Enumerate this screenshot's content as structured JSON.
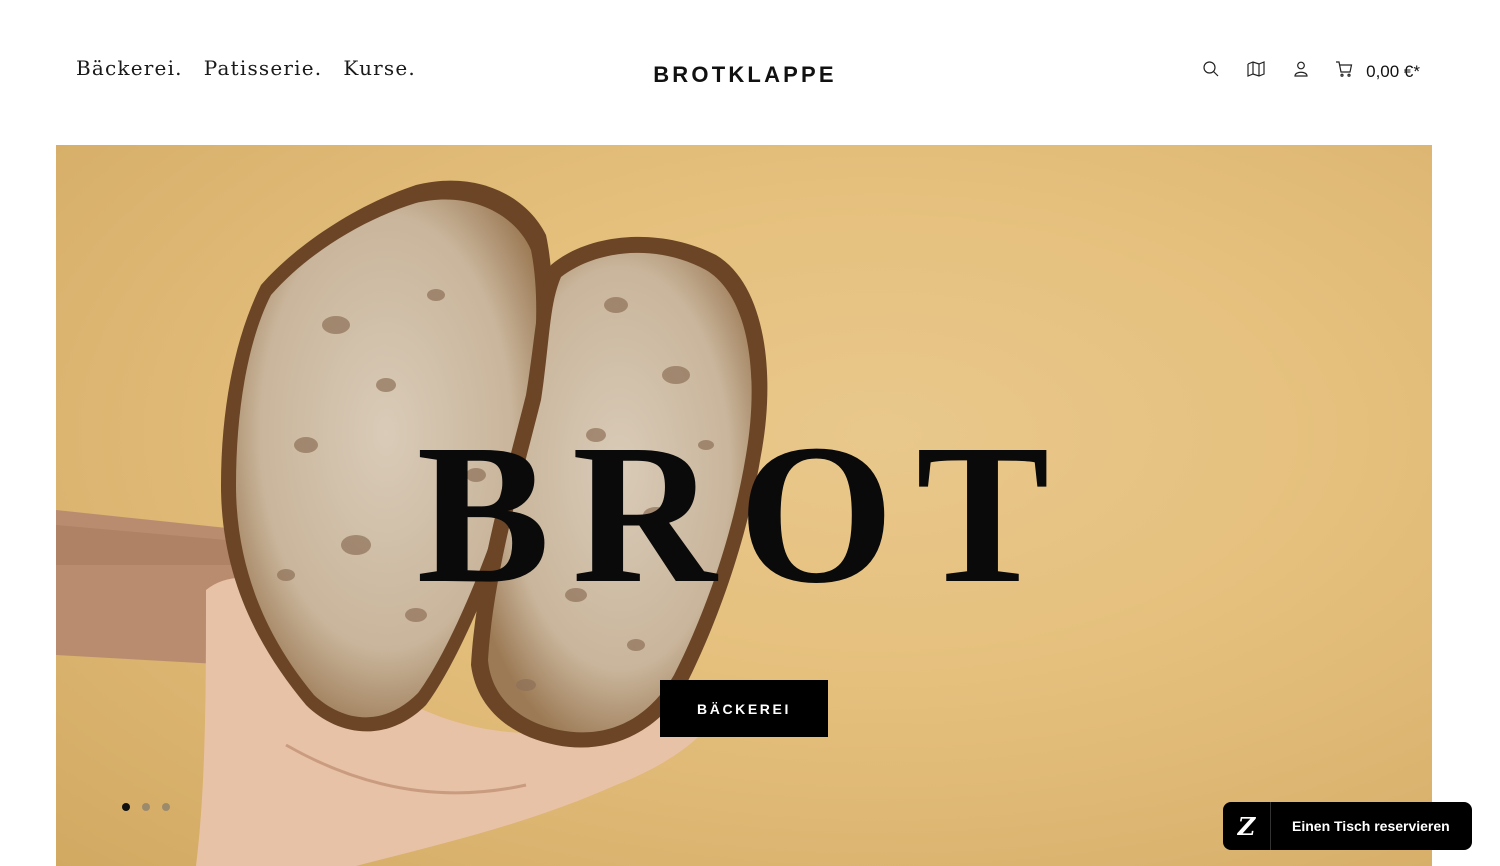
{
  "header": {
    "nav": [
      {
        "label": "Bäckerei."
      },
      {
        "label": "Patisserie."
      },
      {
        "label": "Kurse."
      }
    ],
    "logo": "BROTKLAPPE",
    "icons": {
      "search": "search-icon",
      "map": "map-icon",
      "account": "user-icon",
      "cart": "cart-icon"
    },
    "cart_amount": "0,00 €*"
  },
  "hero": {
    "title": "BROT",
    "button_label": "BÄCKEREI",
    "slides_total": 3,
    "active_slide": 1,
    "background_color": "#e5c07d"
  },
  "reservation": {
    "logo_glyph": "Z",
    "label": "Einen Tisch reservieren"
  }
}
